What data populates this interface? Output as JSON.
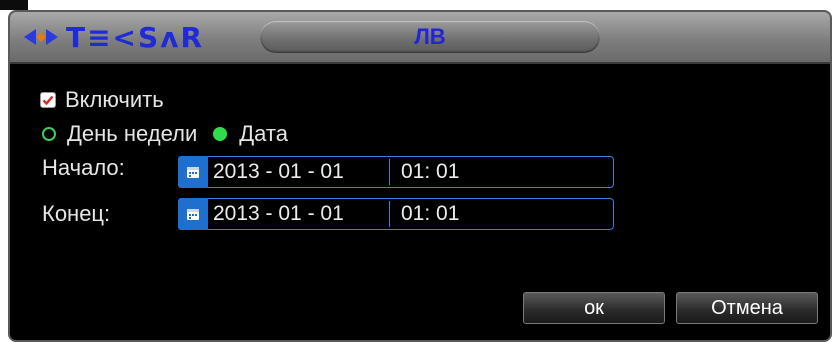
{
  "window": {
    "brand": "T≡<SʌR",
    "title": "ЛВ"
  },
  "form": {
    "enable": {
      "label": "Включить",
      "checked": true
    },
    "mode": {
      "options": [
        {
          "label": "День недели",
          "selected": false
        },
        {
          "label": "Дата",
          "selected": true
        }
      ]
    },
    "start": {
      "label": "Начало:",
      "date": "2013 - 01 - 01",
      "time": "01: 01"
    },
    "end": {
      "label": "Конец:",
      "date": "2013 - 01 - 01",
      "time": "01: 01"
    }
  },
  "buttons": {
    "ok": "ок",
    "cancel": "Отмена"
  },
  "colors": {
    "accent_blue": "#3c7fd9",
    "title_blue": "#2323d8",
    "radio_green": "#2fdc4c",
    "check_red": "#d62a2a"
  },
  "icons": [
    "logo-arrows-icon",
    "checkmark-icon",
    "calendar-icon"
  ]
}
